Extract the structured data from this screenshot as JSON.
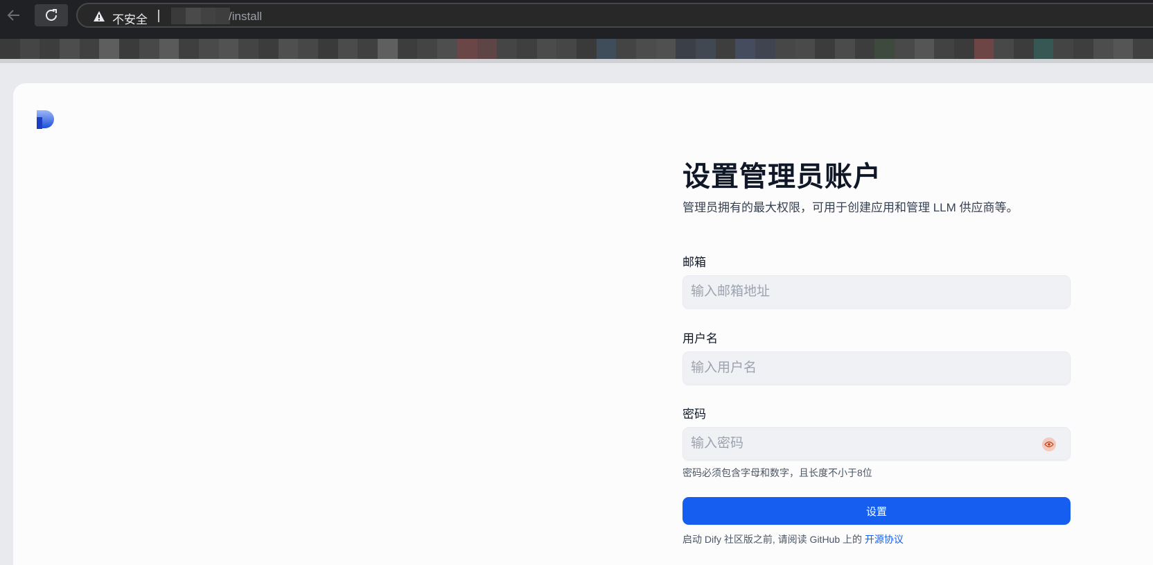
{
  "browser": {
    "security_label": "不安全",
    "url_suffix": "/install",
    "icons": [
      "back-arrow-icon",
      "reload-icon",
      "warning-icon"
    ]
  },
  "colors": {
    "accent": "#155eef",
    "title": "#101828",
    "input_bg": "#f0f1f5",
    "page_bg": "#fcfcfd"
  },
  "page": {
    "title": "设置管理员账户",
    "subtitle": "管理员拥有的最大权限，可用于创建应用和管理 LLM 供应商等。"
  },
  "form": {
    "email": {
      "label": "邮箱",
      "placeholder": "输入邮箱地址",
      "value": ""
    },
    "username": {
      "label": "用户名",
      "placeholder": "输入用户名",
      "value": ""
    },
    "password": {
      "label": "密码",
      "placeholder": "输入密码",
      "value": "",
      "hint": "密码必须包含字母和数字，且长度不小于8位"
    },
    "submit_label": "设置"
  },
  "footer": {
    "text": "启动 Dify 社区版之前, 请阅读 GitHub 上的",
    "link_label": "开源协议"
  }
}
